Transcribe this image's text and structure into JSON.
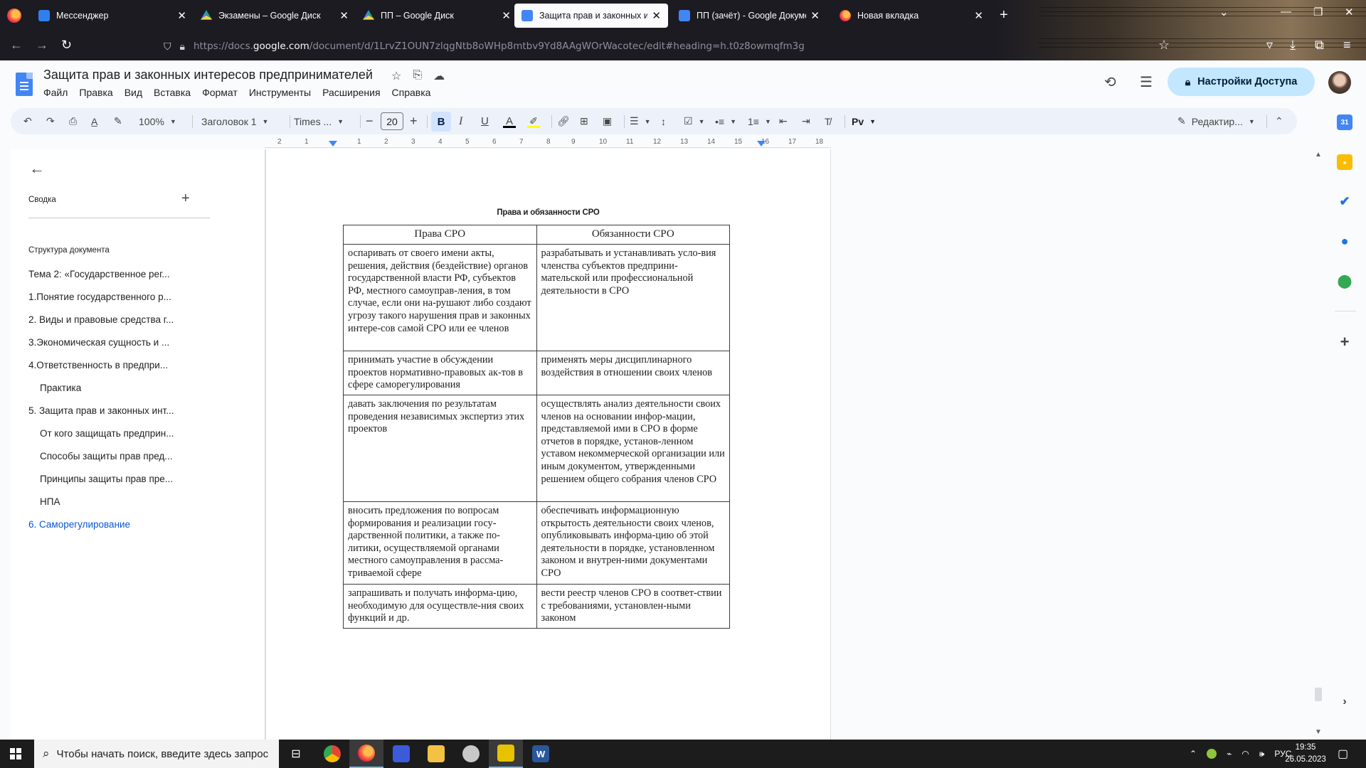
{
  "browser": {
    "tabs": [
      {
        "title": "Мессенджер",
        "icon": "messenger-icon"
      },
      {
        "title": "Экзамены – Google Диск",
        "icon": "google-drive-icon"
      },
      {
        "title": "ПП – Google Диск",
        "icon": "google-drive-icon"
      },
      {
        "title": "Защита прав и законных интересов предпринимателей",
        "icon": "google-docs-icon",
        "active": true
      },
      {
        "title": "ПП (зачёт) - Google Документы",
        "icon": "google-docs-icon"
      },
      {
        "title": "Новая вкладка",
        "icon": "firefox-icon"
      }
    ],
    "url_prefix": "https://docs.",
    "url_domain": "google.com",
    "url_rest": "/document/d/1LrvZ1OUN7zlqgNtb8oWHp8mtbv9Yd8AAgWOrWacotec/edit#heading=h.t0z8owmqfm3g"
  },
  "docs": {
    "title": "Защита прав и законных интересов предпринимателей",
    "menu": [
      "Файл",
      "Правка",
      "Вид",
      "Вставка",
      "Формат",
      "Инструменты",
      "Расширения",
      "Справка"
    ],
    "share_label": "Настройки Доступа",
    "toolbar": {
      "zoom": "100%",
      "style": "Заголовок 1",
      "font": "Times ...",
      "font_size": "20",
      "mode": "Редактир..."
    },
    "ruler_ticks": [
      "2",
      "1",
      "1",
      "2",
      "3",
      "4",
      "5",
      "6",
      "7",
      "8",
      "9",
      "10",
      "11",
      "12",
      "13",
      "14",
      "15",
      "16",
      "17",
      "18"
    ]
  },
  "outline": {
    "summary_label": "Сводка",
    "structure_label": "Структура документа",
    "items": [
      {
        "text": "Тема 2: «Государственное рег...",
        "level": 1
      },
      {
        "text": "1.Понятие государственного р...",
        "level": 1
      },
      {
        "text": "2. Виды и правовые средства г...",
        "level": 1
      },
      {
        "text": "3.Экономическая сущность и ...",
        "level": 1
      },
      {
        "text": "4.Ответственность в предпри...",
        "level": 1
      },
      {
        "text": "Практика",
        "level": 2
      },
      {
        "text": "5. Защита прав и законных инт...",
        "level": 1
      },
      {
        "text": "От кого защищать предприн...",
        "level": 2
      },
      {
        "text": "Способы защиты прав пред...",
        "level": 2
      },
      {
        "text": "Принципы защиты прав пре...",
        "level": 2
      },
      {
        "text": "НПА",
        "level": 2
      },
      {
        "text": "6. Саморегулирование",
        "level": 1,
        "active": true
      }
    ]
  },
  "document": {
    "table_title": "Права и обязанности СРО",
    "headers": [
      "Права СРО",
      "Обязанности СРО"
    ],
    "rows": [
      [
        "оспаривать от своего имени акты, решения, действия (бездействие) органов государственной власти РФ, субъектов РФ, местного самоуправ-ления, в том случае, если они на-рушают либо создают угрозу такого нарушения прав и законных интере-сов самой СРО или ее членов",
        "разрабатывать и устанавливать усло-вия членства субъектов предприни-мательской или профессиональной деятельности в СРО"
      ],
      [
        "принимать участие в обсуждении проектов нормативно-правовых ак-тов в сфере саморегулирования",
        "применять меры дисциплинарного воздействия в отношении своих членов"
      ],
      [
        "давать заключения по результатам проведения независимых экспертиз этих проектов",
        "осуществлять анализ деятельности своих членов на основании инфор-мации, представляемой ими в СРО в форме отчетов в порядке, установ-ленном уставом некоммерческой организации или иным документом, утвержденными решением общего собрания членов СРО"
      ],
      [
        "вносить предложения по вопросам формирования и реализации госу-дарственной политики, а также по-литики, осуществляемой органами местного самоуправления в рассма-триваемой сфере",
        "обеспечивать информационную открытость деятельности своих членов, опубликовывать информа-цию об этой деятельности в порядке, установленном законом и внутрен-ними документами СРО"
      ],
      [
        "запрашивать и получать информа-цию, необходимую для осуществле-ния своих функций и др.",
        "вести реестр членов СРО в соответ-ствии с требованиями, установлен-ными законом"
      ]
    ]
  },
  "taskbar": {
    "search_placeholder": "Чтобы начать поиск, введите здесь запрос",
    "language": "РУС",
    "time": "19:35",
    "date": "26.05.2023"
  }
}
